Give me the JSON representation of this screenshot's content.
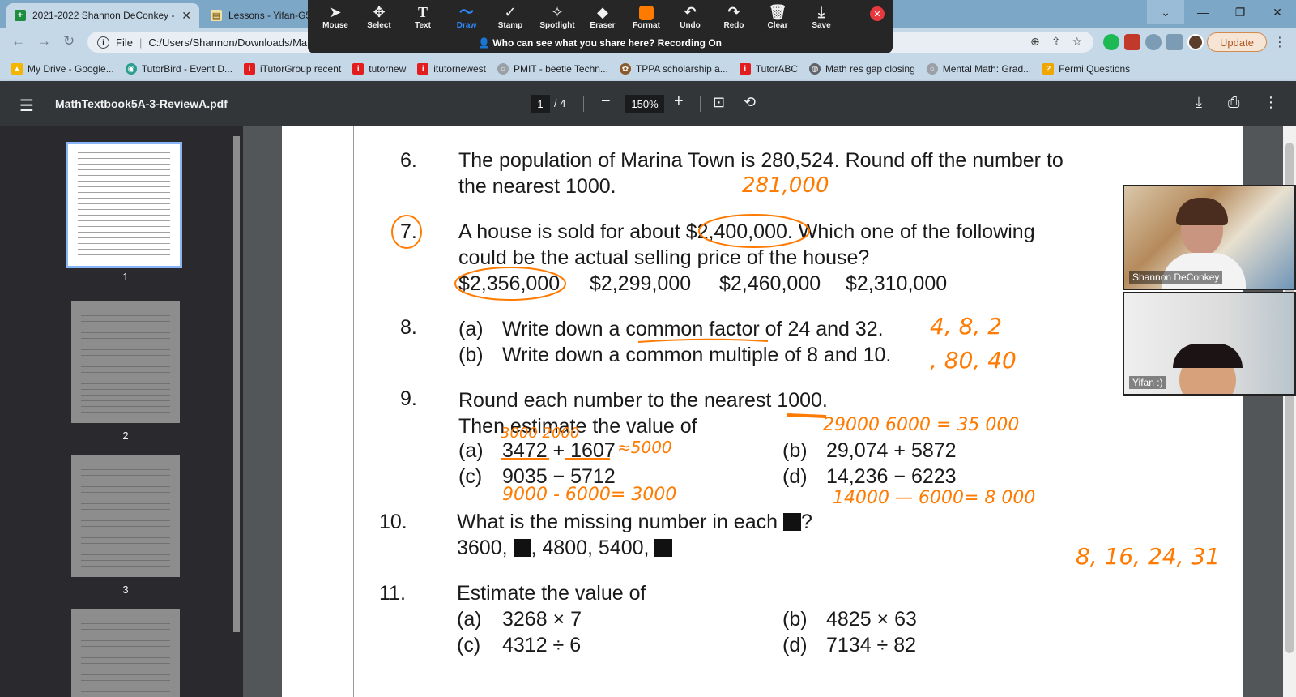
{
  "tabs": [
    {
      "title": "2021-2022 Shannon DeConkey -",
      "close": "✕"
    },
    {
      "title": "Lessons - Yifan-G5"
    }
  ],
  "address": {
    "file_label": "File",
    "url": "C:/Users/Shannon/Downloads/MathTextbook5A-3-ReviewA.pdf"
  },
  "update_label": "Update",
  "bookmarks": [
    "My Drive - Google...",
    "TutorBird - Event D...",
    "iTutorGroup recent",
    "tutornew",
    "itutornewest",
    "PMIT - beetle Techn...",
    "TPPA scholarship a...",
    "TutorABC",
    "Math res gap closing",
    "Mental Math: Grad...",
    "Fermi Questions"
  ],
  "annotate": {
    "tools": [
      "Mouse",
      "Select",
      "Text",
      "Draw",
      "Stamp",
      "Spotlight",
      "Eraser",
      "Format",
      "Undo",
      "Redo",
      "Clear",
      "Save"
    ],
    "selected": "Draw",
    "share_note": "Who can see what you share here? Recording On"
  },
  "pdf": {
    "filename": "MathTextbook5A-3-ReviewA.pdf",
    "page_current": "1",
    "page_total": "/  4",
    "zoom": "150%",
    "thumb_numbers": [
      "1",
      "2",
      "3"
    ]
  },
  "questions": {
    "q6": {
      "num": "6.",
      "line1": "The population of Marina Town is 280,524. Round off the number to",
      "line2": "the nearest 1000."
    },
    "q7": {
      "num": "7.",
      "line1a": "A house is sold for about ",
      "line1b": "$2,400,000.",
      "line1c": " Which one of the following",
      "line2": "could be the actual selling price of the house?",
      "options": [
        "$2,356,000",
        "$2,299,000",
        "$2,460,000",
        "$2,310,000"
      ]
    },
    "q8": {
      "num": "8.",
      "a_label": "(a)",
      "a": "Write down a common factor of 24 and 32.",
      "b_label": "(b)",
      "b": "Write down a common multiple of 8 and 10."
    },
    "q9": {
      "num": "9.",
      "line1": "Round each number to the nearest 1000.",
      "line2": "Then estimate the value of",
      "a_label": "(a)",
      "a": "3472 + 1607",
      "b_label": "(b)",
      "b": "29,074 + 5872",
      "c_label": "(c)",
      "c": "9035 − 5712",
      "d_label": "(d)",
      "d": "14,236 − 6223"
    },
    "q10": {
      "num": "10.",
      "line1": "What is the missing number in each",
      "line1_end": "?",
      "line2a": "3600,",
      "line2b": ", 4800, 5400,"
    },
    "q11": {
      "num": "11.",
      "line1": "Estimate the value of",
      "a_label": "(a)",
      "a": "3268 × 7",
      "b_label": "(b)",
      "b": "4825 × 63",
      "c_label": "(c)",
      "c": "4312 ÷ 6",
      "d_label": "(d)",
      "d": "7134 ÷ 82"
    }
  },
  "handwriting": {
    "q6": "281,000",
    "q8a": "4, 8, 2",
    "q8b": ", 80, 40",
    "q9_top": "3000  2000",
    "q9a": "≈5000",
    "q9b": "29000   6000 = 35 000",
    "q9c": "9000 - 6000= 3000",
    "q9d": "14000 — 6000= 8 000",
    "q10": "8, 16, 24, 31"
  },
  "participants": [
    "Shannon DeConkey",
    "Yifan :)"
  ]
}
